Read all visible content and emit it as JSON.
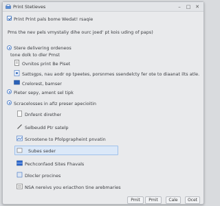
{
  "window": {
    "title": "Print Stetieves"
  },
  "options": {
    "top_checkbox": "Print Print  pals bome Wedat! rsaqie",
    "line2": "Pms the nev pels vmystaliy dihe  ourc joed' pt kois uding of paps)",
    "radio1": "Stere delivering ordeneos",
    "line4": "tone dolk to dler Pmst",
    "item5": "Ovnitos print Be Piset",
    "item6": "Sattsgps, nau aodr op tpeetes, porsnmes ssendelcty fer ote to diaanat ilts atle.",
    "item7": "Crelorest, bamser",
    "radio2": "Pieter sepy, ament sel tipk",
    "radio3": "Scracelosses in afiz preser apecioitin",
    "item10": "Dnfesnt direther",
    "item11": "Selbeudd Ptr satelp",
    "item12": "Scrootene to Pfolpgrapheint pnvatin",
    "item13": "Subes seder",
    "item14": "Pechconfaod Sites Fhavals",
    "item15": "Dlocler procines",
    "item16": "NSA nereivs you eriacthon tine arebmaries"
  },
  "footer": {
    "btn1": "Pmit",
    "btn2": "Pmit",
    "btn3": "Cale",
    "btn4": "Ocet"
  }
}
